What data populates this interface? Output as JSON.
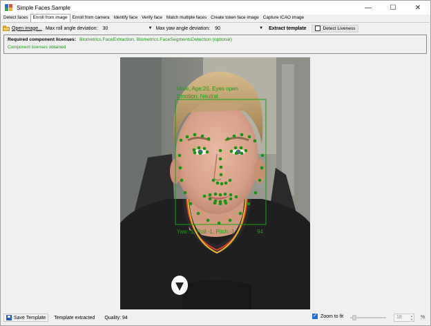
{
  "window": {
    "title": "Simple Faces Sample",
    "controls": {
      "minimize": "—",
      "maximize": "☐",
      "close": "✕"
    }
  },
  "tabs": [
    {
      "label": "Detect faces",
      "active": false
    },
    {
      "label": "Enroll from image",
      "active": true
    },
    {
      "label": "Enroll from camera",
      "active": false
    },
    {
      "label": "Identify face",
      "active": false
    },
    {
      "label": "Verify face",
      "active": false
    },
    {
      "label": "Match multiple faces",
      "active": false
    },
    {
      "label": "Create token face image",
      "active": false
    },
    {
      "label": "Capture ICAO image",
      "active": false
    }
  ],
  "toolbar": {
    "open_image": "Open image...",
    "roll_label": "Max roll angle deviation:",
    "roll_value": "30",
    "yaw_label": "Max yaw angle deviation:",
    "yaw_value": "90",
    "extract_template": "Extract template",
    "detect_liveness": "Detect Liveness",
    "detect_liveness_checked": false
  },
  "licenses": {
    "label": "Required component licenses:",
    "components": "Biometrics.FaceExtraction, Biometrics.FaceSegmentsDetection (optional)",
    "status": "Component licenses obtained",
    "status_color": "#1a9a1a"
  },
  "face_overlay": {
    "top_text_line1": "Male, Age:20, Eyes open",
    "top_text_line2": "Emotion: Neutral",
    "bottom_text": "Yaw:-1, Roll:-1, Pitch:-1",
    "bottom_score": "94",
    "overlay_color": "#17a017"
  },
  "statusbar": {
    "save_template": "Save Template",
    "status": "Template extracted",
    "quality": "Quality: 94",
    "zoom_to_fit": "Zoom to fit",
    "zoom_to_fit_checked": true,
    "zoom_value": "18",
    "zoom_unit": "%"
  }
}
